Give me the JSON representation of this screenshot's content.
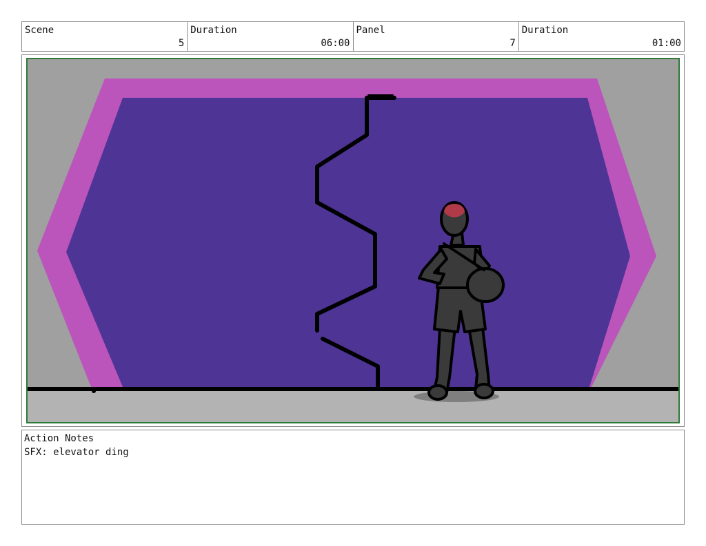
{
  "header": {
    "scene": {
      "label": "Scene",
      "value": "5"
    },
    "scene_duration": {
      "label": "Duration",
      "value": "06:00"
    },
    "panel": {
      "label": "Panel",
      "value": "7"
    },
    "panel_duration": {
      "label": "Duration",
      "value": "01:00"
    }
  },
  "notes": {
    "label": "Action Notes",
    "text": "SFX: elevator ding"
  },
  "colors": {
    "frame_border": "#8a8a8a",
    "panel_border": "#2f7a3a",
    "wall": "#a0a0a0",
    "floor": "#b3b3b3",
    "door_frame": "#bb55bb",
    "doors": "#4e3595",
    "figure": "#3a3a3a",
    "hair": "#b03a48"
  },
  "icons": {
    "drawing": "storyboard-drawing"
  }
}
